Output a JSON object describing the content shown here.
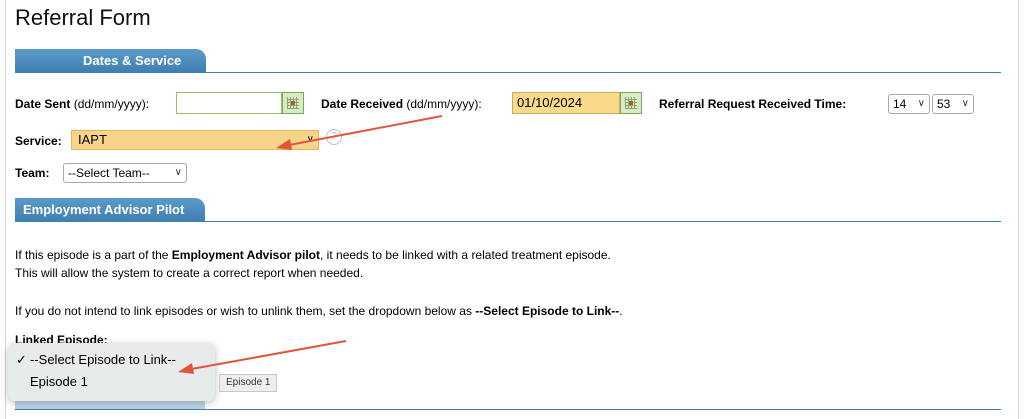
{
  "page": {
    "title": "Referral Form"
  },
  "sections": {
    "dates_service": "Dates & Service",
    "employment": "Employment Advisor Pilot"
  },
  "dates": {
    "date_sent_label": "Date Sent",
    "date_sent_format": "(dd/mm/yyyy):",
    "date_sent_value": "",
    "date_received_label": "Date Received",
    "date_received_format": "(dd/mm/yyyy):",
    "date_received_value": "01/10/2024",
    "time_label": "Referral Request Received Time:",
    "time_hour": "14",
    "time_minute": "53"
  },
  "service": {
    "label": "Service:",
    "value": "IAPT"
  },
  "team": {
    "label": "Team:",
    "value": "--Select Team--"
  },
  "employment": {
    "line1_pre": "If this episode is a part of the ",
    "line1_bold": "Employment Advisor pilot",
    "line1_post": ", it needs to be linked with a related treatment episode.",
    "line2": "This will allow the system to create a correct report when needed.",
    "line3_pre": "If you do not intend to link episodes or wish to unlink them, set the dropdown below as ",
    "line3_bold": "--Select Episode to Link--",
    "line3_post": ".",
    "linked_label": "Linked Episode:"
  },
  "linked_dropdown": {
    "options": [
      {
        "label": "--Select Episode to Link--",
        "checked": true
      },
      {
        "label": "Episode 1",
        "checked": false
      }
    ],
    "tooltip": "Episode 1"
  },
  "icons": {
    "check": "✓",
    "chevron": "∨",
    "help": "?"
  },
  "colors": {
    "accent": "#3f80b3",
    "highlight": "#f7d48a",
    "annotation_arrow": "#e0563a"
  }
}
